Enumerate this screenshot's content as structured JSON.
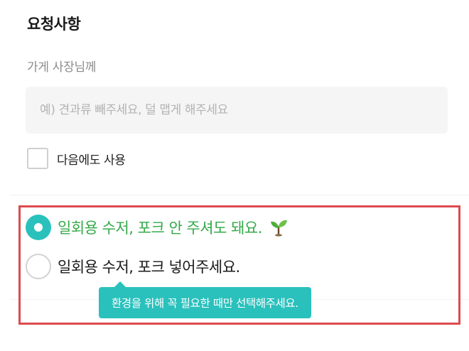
{
  "request": {
    "title": "요청사항",
    "owner_label": "가게 사장님께",
    "input_value": "",
    "input_placeholder": "예) 견과류 빼주세요, 덜 맵게 해주세요",
    "reuse_label": "다음에도 사용",
    "reuse_checked": false
  },
  "cutlery": {
    "options": [
      {
        "label": "일회용 수저, 포크 안 주셔도 돼요.",
        "selected": true,
        "icon": "sprout-icon"
      },
      {
        "label": "일회용 수저, 포크 넣어주세요.",
        "selected": false
      }
    ],
    "tooltip": "환경을 위해 꼭 필요한 때만 선택해주세요."
  },
  "colors": {
    "accent": "#2ac1bc",
    "selected_text": "#35a94a",
    "highlight_border": "#dc4b4f"
  }
}
